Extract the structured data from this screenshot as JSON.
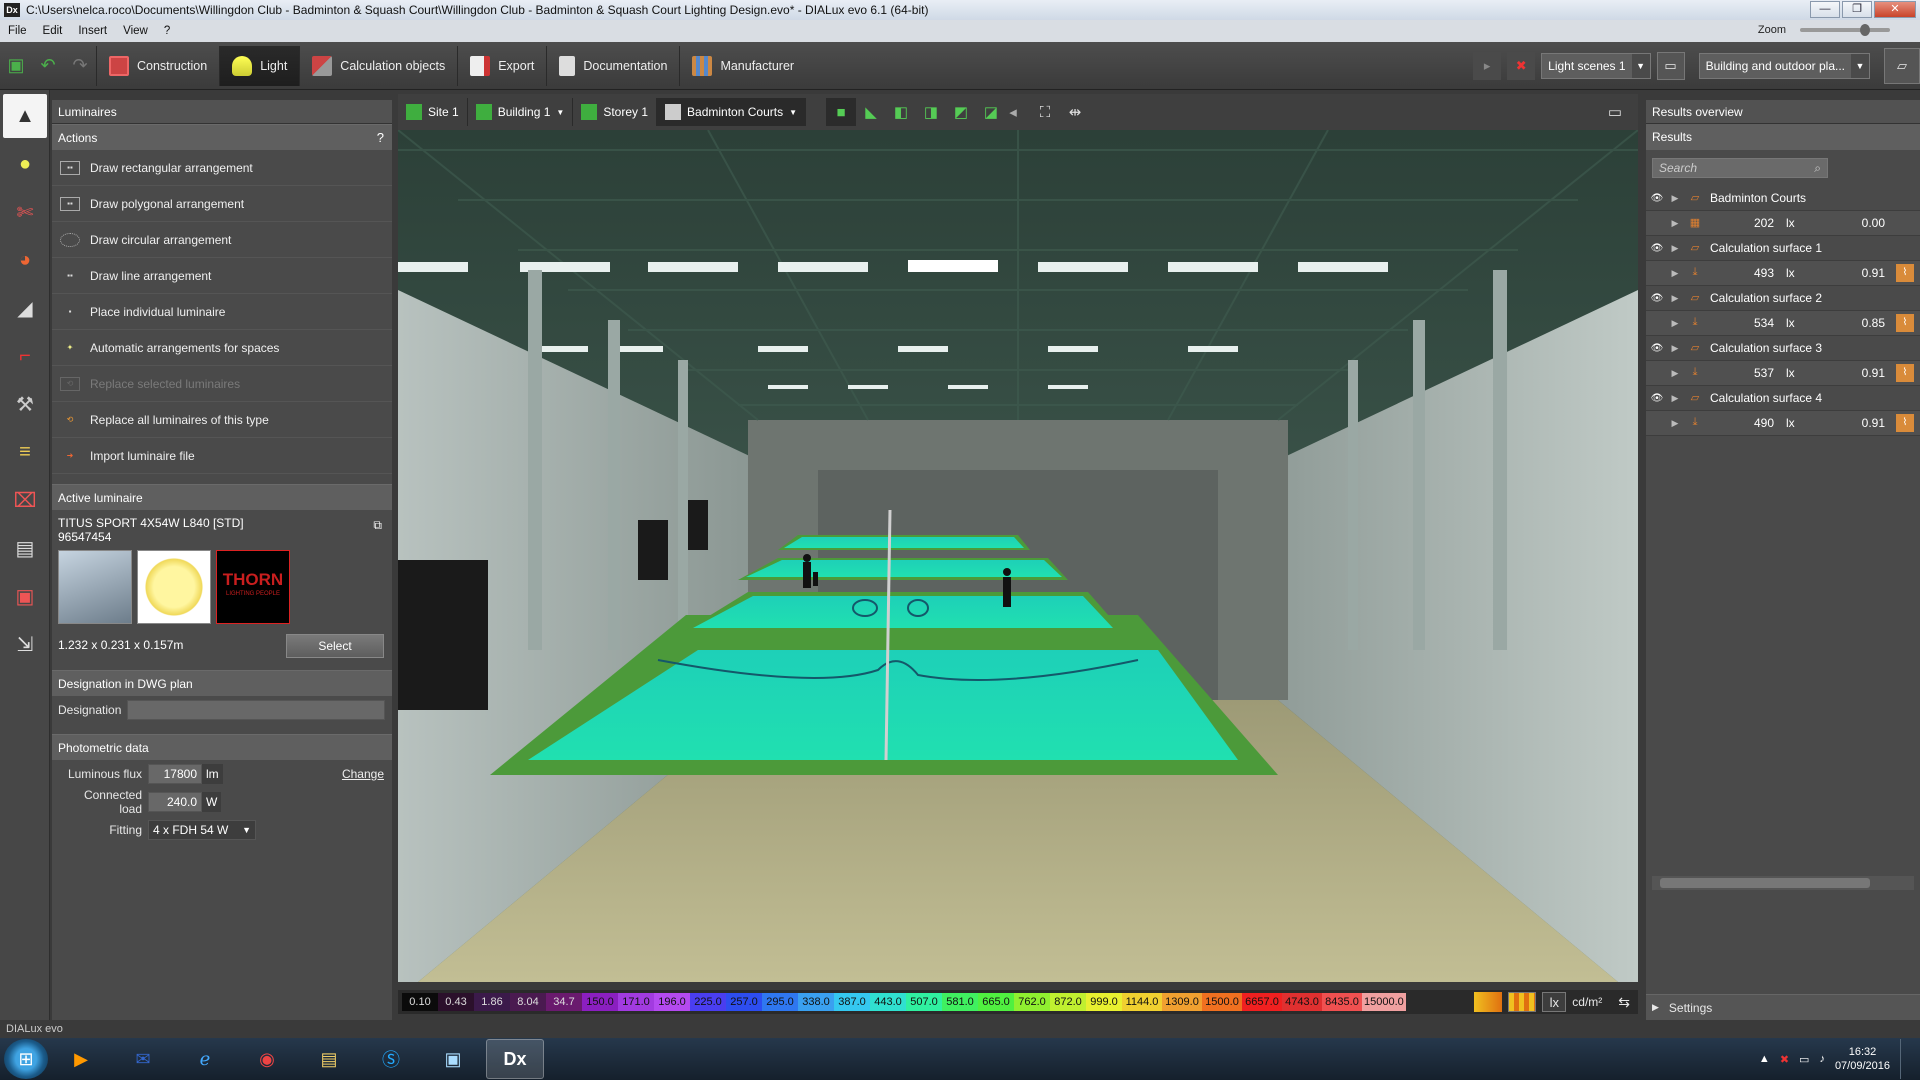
{
  "window": {
    "title": "C:\\Users\\nelca.roco\\Documents\\Willingdon Club - Badminton & Squash Court\\Willingdon Club - Badminton & Squash Court Lighting Design.evo* - DIALux evo 6.1  (64-bit)",
    "app_icon": "Dx"
  },
  "menu": {
    "items": [
      "File",
      "Edit",
      "Insert",
      "View",
      "?"
    ],
    "zoom_label": "Zoom"
  },
  "toolbar": {
    "modes": [
      {
        "label": "Construction",
        "icon": "construction-icon"
      },
      {
        "label": "Light",
        "icon": "light-icon"
      },
      {
        "label": "Calculation objects",
        "icon": "calculation-objects-icon"
      },
      {
        "label": "Export",
        "icon": "export-icon"
      },
      {
        "label": "Documentation",
        "icon": "documentation-icon"
      },
      {
        "label": "Manufacturer",
        "icon": "manufacturer-icon"
      }
    ],
    "active_mode": "Light",
    "light_scenes": "Light scenes 1",
    "view_mode": "Building and outdoor pla..."
  },
  "left_panel": {
    "header": "Luminaires",
    "actions_header": "Actions",
    "help": "?",
    "actions": [
      {
        "label": "Draw rectangular arrangement",
        "enabled": true
      },
      {
        "label": "Draw polygonal arrangement",
        "enabled": true
      },
      {
        "label": "Draw circular arrangement",
        "enabled": true
      },
      {
        "label": "Draw line arrangement",
        "enabled": true
      },
      {
        "label": "Place individual luminaire",
        "enabled": true
      },
      {
        "label": "Automatic arrangements for spaces",
        "enabled": true
      },
      {
        "label": "Replace selected luminaires",
        "enabled": false
      },
      {
        "label": "Replace all luminaires of this type",
        "enabled": true
      },
      {
        "label": "Import luminaire file",
        "enabled": true
      }
    ],
    "active_luminaire": {
      "header": "Active luminaire",
      "name": "TITUS SPORT 4X54W L840 [STD]",
      "code": "96547454",
      "brand": "THORN",
      "brand_tagline": "LIGHTING PEOPLE",
      "dimensions": "1.232 x 0.231 x 0.157m",
      "select_label": "Select"
    },
    "designation": {
      "header": "Designation in DWG plan",
      "label": "Designation",
      "value": ""
    },
    "photometric": {
      "header": "Photometric data",
      "flux_label": "Luminous flux",
      "flux_value": "17800",
      "flux_unit": "lm",
      "change_label": "Change",
      "load_label": "Connected load",
      "load_value": "240.0",
      "load_unit": "W",
      "fitting_label": "Fitting",
      "fitting_value": "4 x FDH 54 W"
    }
  },
  "view_toolbar": {
    "site": "Site 1",
    "building": "Building 1",
    "storey": "Storey 1",
    "space": "Badminton Courts"
  },
  "legend": {
    "values": [
      "0.10",
      "0.43",
      "1.86",
      "8.04",
      "34.7",
      "150.0",
      "171.0",
      "196.0",
      "225.0",
      "257.0",
      "295.0",
      "338.0",
      "387.0",
      "443.0",
      "507.0",
      "581.0",
      "665.0",
      "762.0",
      "872.0",
      "999.0",
      "1144.0",
      "1309.0",
      "1500.0",
      "6657.0",
      "4743.0",
      "8435.0",
      "15000.0"
    ],
    "colors": [
      "#0b0b0b",
      "#2b102b",
      "#3b1a4a",
      "#4a1a50",
      "#6a1a6e",
      "#8b1fc0",
      "#a23be0",
      "#b44af0",
      "#4a3ef0",
      "#2d4df0",
      "#2f77f0",
      "#3aa0f0",
      "#35c8f0",
      "#30e0d0",
      "#30f0a0",
      "#40f060",
      "#50f040",
      "#90f030",
      "#c0f030",
      "#e8f030",
      "#f0d030",
      "#f0a030",
      "#f07020",
      "#f02020",
      "#e03030",
      "#f05050",
      "#f0a0a0"
    ],
    "unit_lx": "lx",
    "unit_cdm2": "cd/m²"
  },
  "results": {
    "header": "Results overview",
    "sub": "Results",
    "search_placeholder": "Search",
    "rows": [
      {
        "name": "Badminton Courts",
        "value": "202",
        "unit": "lx",
        "g": "0.00"
      },
      {
        "name": "Calculation surface 1",
        "value": "493",
        "unit": "lx",
        "g": "0.91"
      },
      {
        "name": "Calculation surface 2",
        "value": "534",
        "unit": "lx",
        "g": "0.85"
      },
      {
        "name": "Calculation surface 3",
        "value": "537",
        "unit": "lx",
        "g": "0.91"
      },
      {
        "name": "Calculation surface 4",
        "value": "490",
        "unit": "lx",
        "g": "0.91"
      }
    ],
    "settings": "Settings"
  },
  "status": {
    "text": "DIALux evo"
  },
  "taskbar": {
    "time": "16:32",
    "date": "07/09/2016",
    "active_app": "Dx"
  }
}
